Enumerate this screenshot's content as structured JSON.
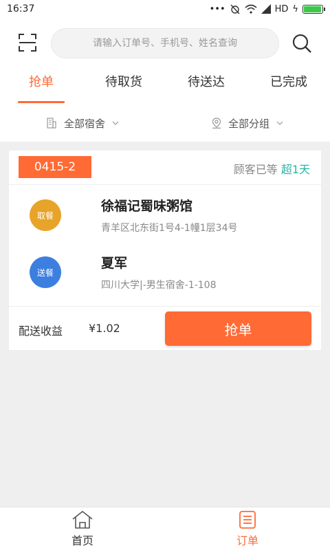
{
  "status_bar": {
    "time": "16:37",
    "network": "HD"
  },
  "search": {
    "placeholder": "请输入订单号、手机号、姓名查询"
  },
  "tabs": [
    {
      "label": "抢单",
      "active": true
    },
    {
      "label": "待取货",
      "active": false
    },
    {
      "label": "待送达",
      "active": false
    },
    {
      "label": "已完成",
      "active": false
    }
  ],
  "filters": {
    "dorm": "全部宿舍",
    "group": "全部分组"
  },
  "order": {
    "number": "0415-2",
    "wait_prefix": "顾客已等",
    "wait_value": "超1天",
    "pickup": {
      "badge": "取餐",
      "name": "徐福记蜀味粥馆",
      "address": "青羊区北东街1号4-1幢1层34号"
    },
    "delivery": {
      "badge": "送餐",
      "name": "夏军",
      "address": "四川大学|-男生宿舍-1-108"
    },
    "fee_label": "配送收益",
    "fee_value": "¥1.02",
    "grab_label": "抢单"
  },
  "bottom_nav": [
    {
      "label": "首页",
      "icon": "home-icon",
      "active": false
    },
    {
      "label": "订单",
      "icon": "order-list-icon",
      "active": true
    }
  ],
  "colors": {
    "accent": "#ff6a35",
    "highlight": "#26b5a4",
    "pickup": "#e8a42a",
    "delivery": "#3c7fe0"
  }
}
